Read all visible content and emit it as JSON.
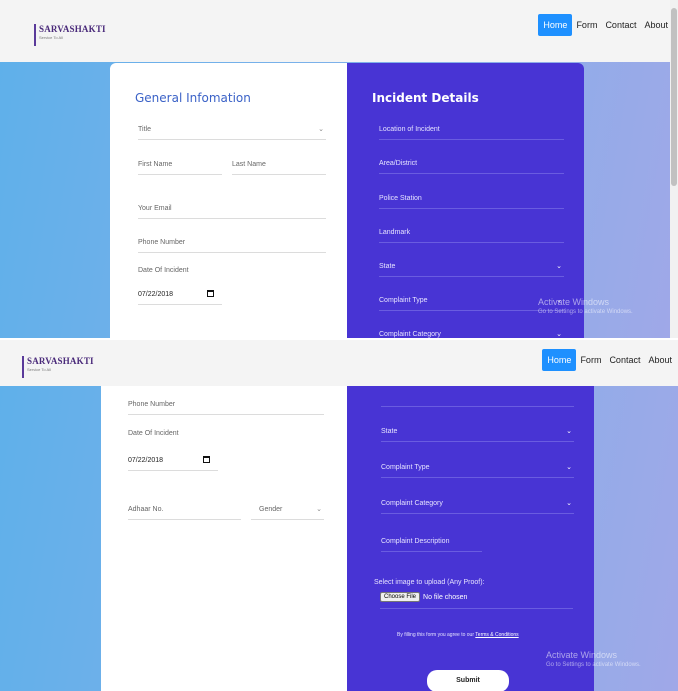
{
  "brand": {
    "name": "SARVASHAKTI",
    "tagline": "Service To All"
  },
  "nav": {
    "items": [
      "Home",
      "Form",
      "Contact",
      "About"
    ],
    "active": "Home",
    "active_color": "#1e90ff"
  },
  "general": {
    "heading": "General Infomation",
    "title_placeholder": "Title",
    "first_name_placeholder": "First Name",
    "last_name_placeholder": "Last Name",
    "email_placeholder": "Your Email",
    "phone_placeholder": "Phone Number",
    "date_label": "Date Of Incident",
    "date_value": "07/22/2018",
    "adhaar_placeholder": "Adhaar No.",
    "gender_placeholder": "Gender"
  },
  "incident": {
    "heading": "Incident Details",
    "location_placeholder": "Location of Incident",
    "area_placeholder": "Area/District",
    "police_placeholder": "Police Station",
    "landmark_placeholder": "Landmark",
    "state_placeholder": "State",
    "complaint_type_placeholder": "Complaint Type",
    "complaint_category_placeholder": "Complaint Category",
    "complaint_description_placeholder": "Complaint Description",
    "upload_label": "Select image to upload (Any Proof):",
    "choose_file_label": "Choose File",
    "file_status": "No file chosen",
    "agree_text": "By filling this form you agree to our",
    "terms_link": "Terms & Conditions",
    "submit_label": "Submit",
    "panel_color": "#4834d4"
  },
  "watermark": {
    "title": "Activate Windows",
    "subtitle": "Go to Settings to activate Windows."
  },
  "icons": {
    "chevron": "chevron-down-icon",
    "calendar": "calendar-icon"
  }
}
